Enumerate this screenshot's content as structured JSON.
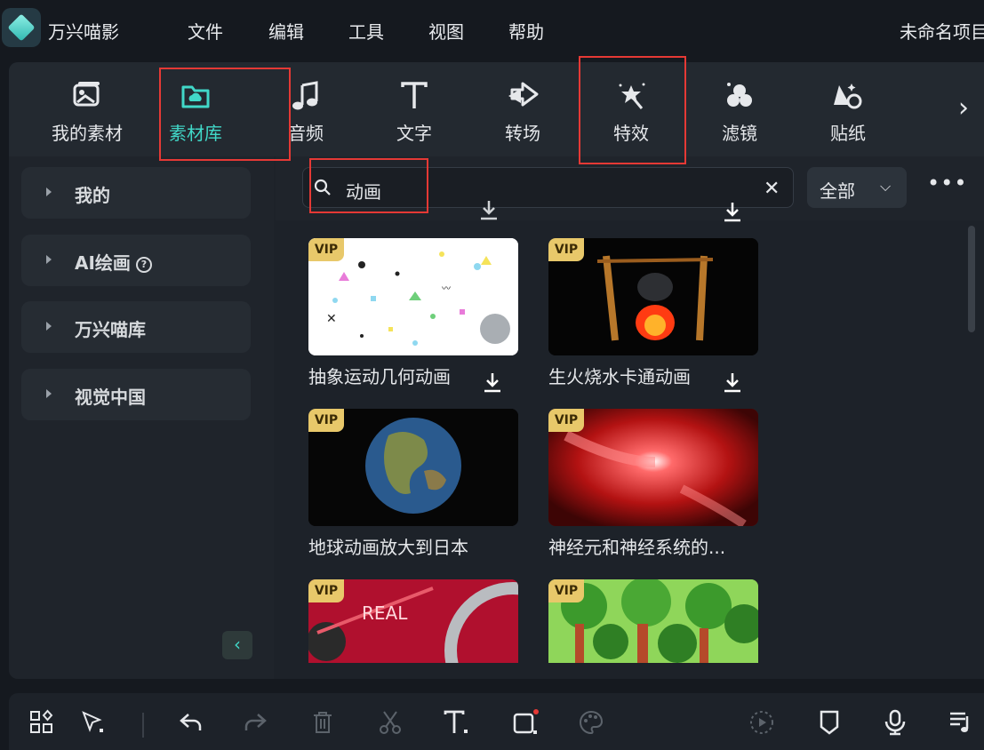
{
  "app": {
    "name": "万兴喵影",
    "project_name": "未命名项目"
  },
  "menu": [
    "文件",
    "编辑",
    "工具",
    "视图",
    "帮助"
  ],
  "toolbar": {
    "tabs": [
      {
        "label": "我的素材",
        "icon": "my-media-icon"
      },
      {
        "label": "素材库",
        "icon": "cloud-folder-icon",
        "active": true
      },
      {
        "label": "音频",
        "icon": "music-note-icon"
      },
      {
        "label": "文字",
        "icon": "text-t-icon"
      },
      {
        "label": "转场",
        "icon": "transition-arrows-icon"
      },
      {
        "label": "特效",
        "icon": "magic-star-icon"
      },
      {
        "label": "滤镜",
        "icon": "filter-circles-icon"
      },
      {
        "label": "贴纸",
        "icon": "sticker-icon"
      }
    ],
    "accent_color": "#41d8c8"
  },
  "sidebar": {
    "items": [
      {
        "label": "我的"
      },
      {
        "label": "AI绘画"
      },
      {
        "label": "万兴喵库"
      },
      {
        "label": "视觉中国"
      }
    ]
  },
  "search": {
    "value": "动画",
    "filter_label": "全部"
  },
  "results": [
    {
      "title": "抽象运动几何动画",
      "badge": "VIP"
    },
    {
      "title": "生火烧水卡通动画",
      "badge": "VIP"
    },
    {
      "title": "地球动画放大到日本",
      "badge": "VIP"
    },
    {
      "title": "神经元和神经系统的...",
      "badge": "VIP"
    },
    {
      "title": "",
      "badge": "VIP",
      "thumb_text": "REAL"
    },
    {
      "title": "",
      "badge": "VIP"
    }
  ],
  "bottom_toolbar": [
    "layout-icon",
    "select-pointer-icon",
    "undo-icon",
    "redo-icon",
    "delete-icon",
    "cut-icon",
    "text-icon",
    "crop-icon",
    "color-palette-icon",
    "render-preview-icon",
    "marker-icon",
    "microphone-icon",
    "audio-list-icon"
  ]
}
